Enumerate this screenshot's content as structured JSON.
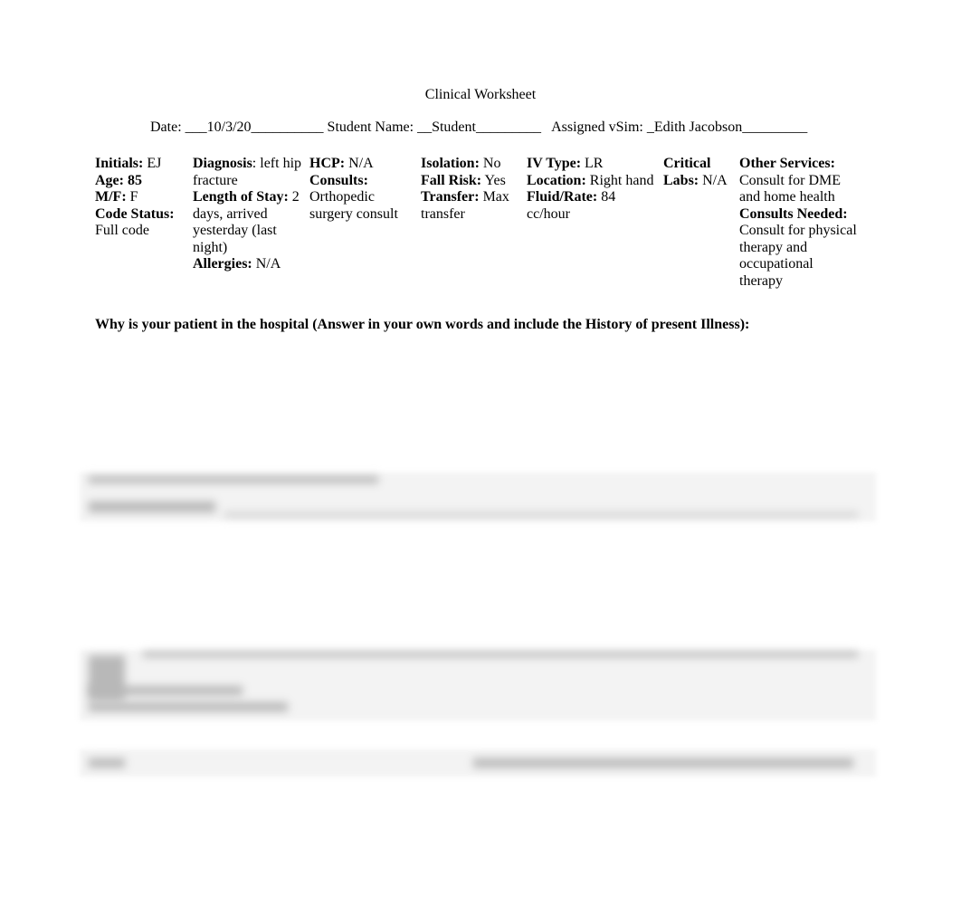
{
  "document": {
    "title": "Clinical Worksheet",
    "meta_line": "Date: ___10/3/20__________ Student Name: __Student_________   Assigned vSim: _Edith Jacobson_________"
  },
  "columns": [
    {
      "fields": [
        {
          "label": "Initials:",
          "value": " EJ"
        },
        {
          "label": "Age: 85",
          "value": ""
        },
        {
          "label": "M/F:",
          "value": " F"
        },
        {
          "label": "Code Status:",
          "value": " Full code"
        }
      ]
    },
    {
      "fields": [
        {
          "label": "Diagnosis",
          "value": ": left hip fracture"
        },
        {
          "label": "Length of Stay:",
          "value": " 2 days, arrived yesterday (last night)"
        },
        {
          "label": "Allergies:",
          "value": " N/A"
        }
      ]
    },
    {
      "fields": [
        {
          "label": "HCP:",
          "value": "  N/A"
        },
        {
          "label": "Consults:",
          "value": " Orthopedic surgery consult"
        }
      ]
    },
    {
      "fields": [
        {
          "label": "Isolation:",
          "value": " No"
        },
        {
          "label": "Fall Risk:",
          "value": " Yes"
        },
        {
          "label": "Transfer:",
          "value": " Max transfer"
        }
      ]
    },
    {
      "fields": [
        {
          "label": "IV Type:",
          "value": " LR"
        },
        {
          "label": "Location:",
          "value": " Right hand"
        },
        {
          "label": "Fluid/Rate:",
          "value": " 84 cc/hour"
        }
      ]
    },
    {
      "fields": [
        {
          "label": "Critical Labs:",
          "value": " N/A"
        }
      ]
    },
    {
      "fields": [
        {
          "label": "Other Services:",
          "value": " Consult for DME and home health"
        },
        {
          "label": "Consults Needed:",
          "value": " Consult for physical therapy and occupational therapy"
        }
      ]
    }
  ],
  "question": "Why is your patient in the hospital (Answer in your own words and include the History of present Illness):"
}
